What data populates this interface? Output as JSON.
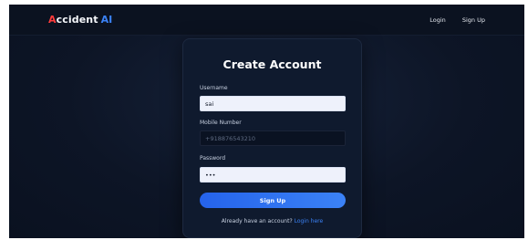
{
  "navbar": {
    "brand_first_letter": "A",
    "brand_rest": "ccident",
    "brand_suffix": "AI",
    "login_label": "Login",
    "signup_label": "Sign Up"
  },
  "form": {
    "title": "Create Account",
    "username_label": "Username",
    "username_value": "sai",
    "mobile_label": "Mobile Number",
    "mobile_placeholder": "+918876543210",
    "password_label": "Password",
    "password_value": "abc",
    "submit_label": "Sign Up",
    "footer_text": "Already have an account?",
    "footer_link": "Login here"
  },
  "colors": {
    "accent": "#3b82f6",
    "brand_red": "#ff3b3b",
    "background": "#0d1526",
    "card": "#0f1a2e"
  }
}
